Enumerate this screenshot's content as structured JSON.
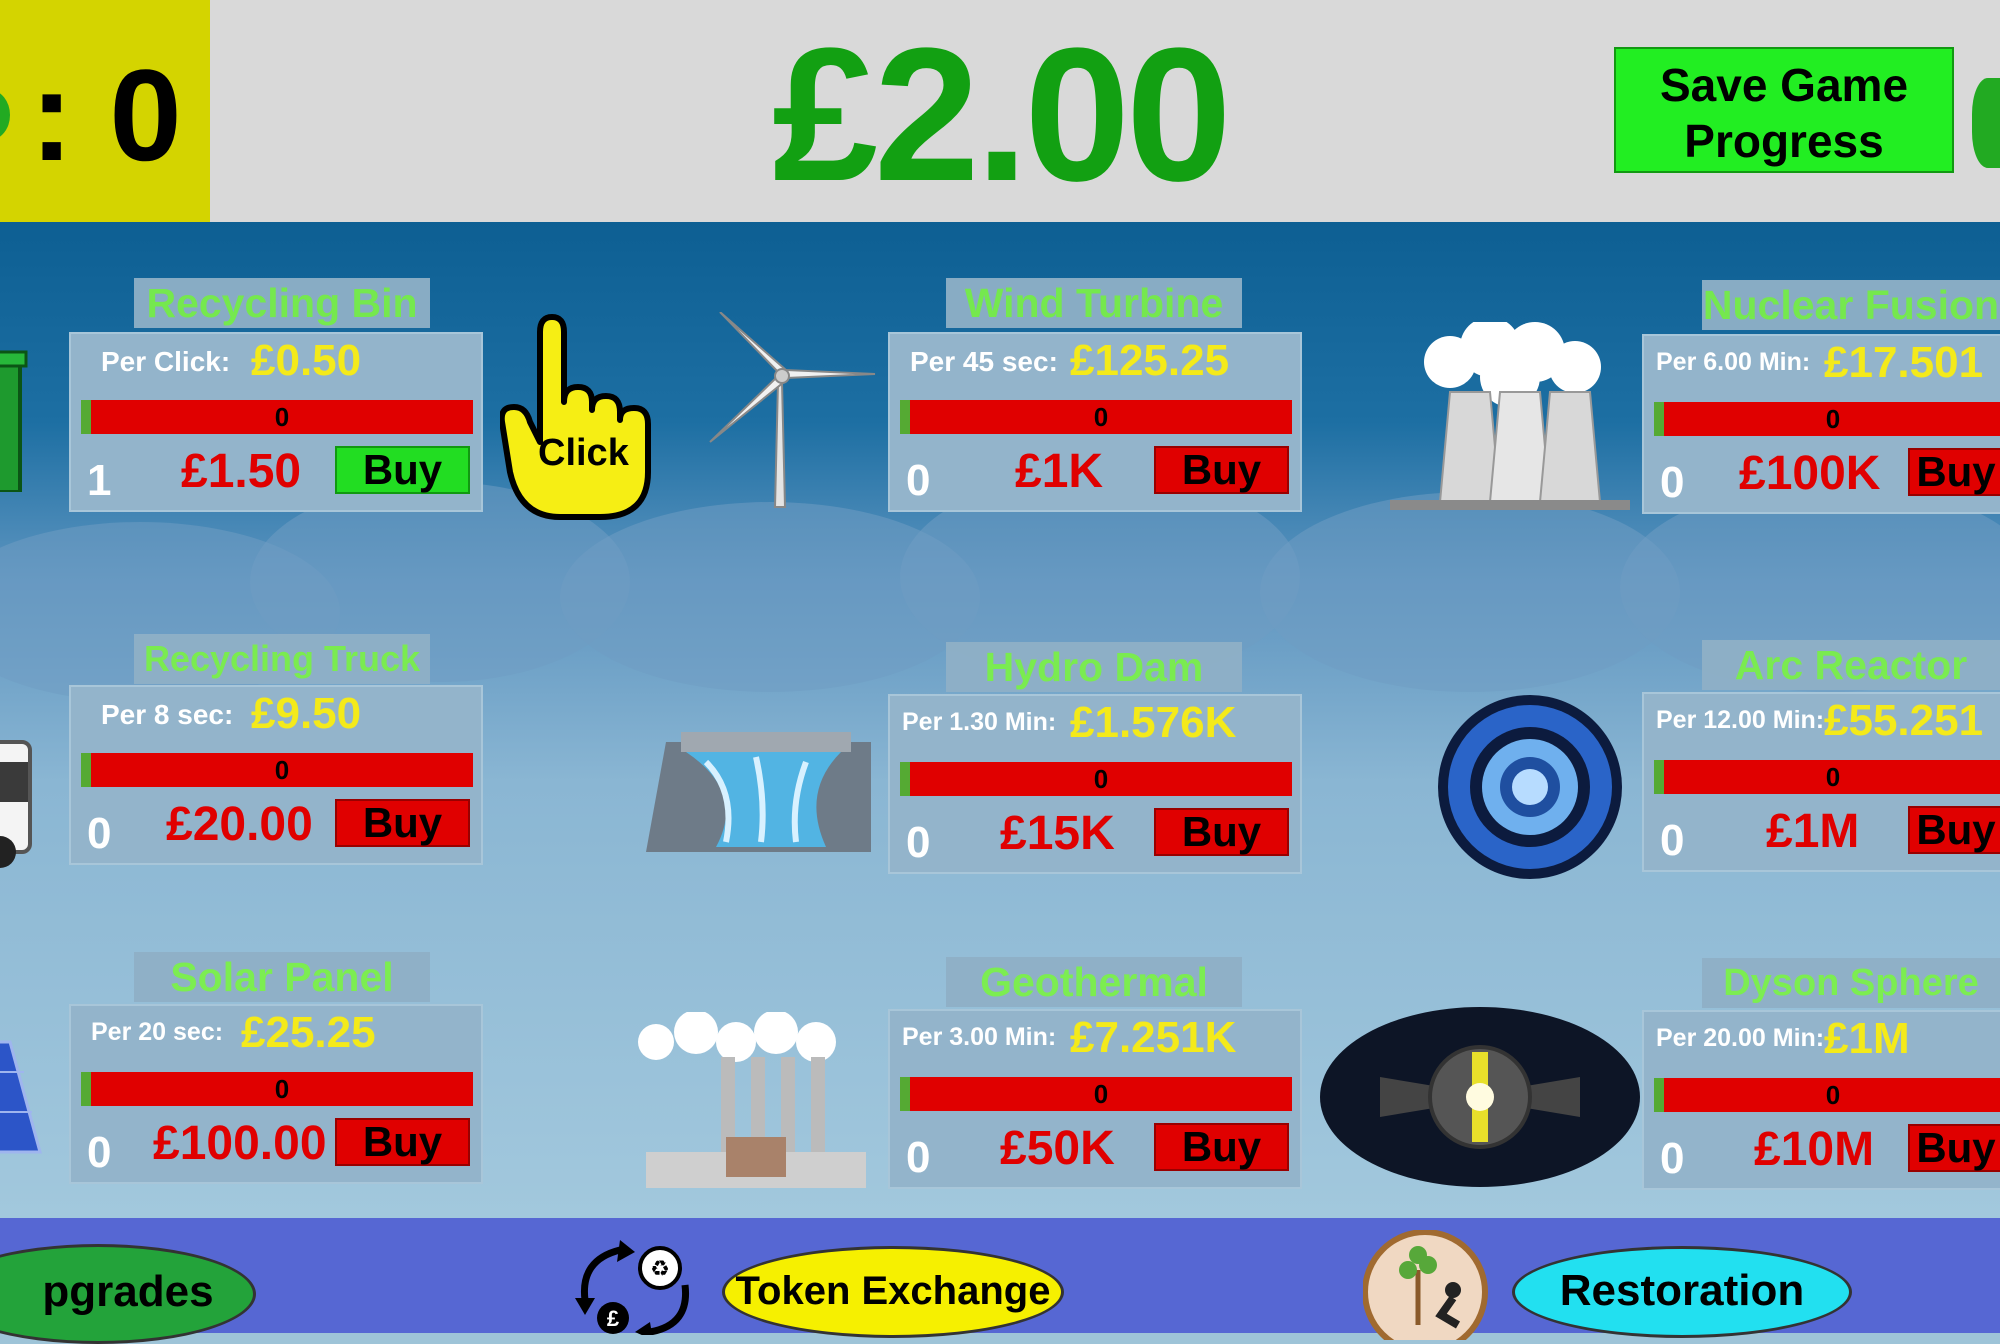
{
  "header": {
    "token_separator_value": ": 0",
    "money": "£2.00",
    "save_button_line1": "Save Game",
    "save_button_line2": "Progress"
  },
  "click_button": {
    "label": "Click"
  },
  "cards": [
    {
      "title": "Recycling Bin",
      "per_label": "Per Click:",
      "per_value": "£0.50",
      "progress": "0",
      "owned": "1",
      "price": "£1.50",
      "buy": "Buy",
      "buy_color": "#22dd22"
    },
    {
      "title": "Recycling Truck",
      "per_label": "Per 8 sec:",
      "per_value": "£9.50",
      "progress": "0",
      "owned": "0",
      "price": "£20.00",
      "buy": "Buy",
      "buy_color": "#e00000"
    },
    {
      "title": "Solar Panel",
      "per_label": "Per 20 sec:",
      "per_value": "£25.25",
      "progress": "0",
      "owned": "0",
      "price": "£100.00",
      "buy": "Buy",
      "buy_color": "#e00000"
    },
    {
      "title": "Wind Turbine",
      "per_label": "Per 45 sec:",
      "per_value": "£125.25",
      "progress": "0",
      "owned": "0",
      "price": "£1K",
      "buy": "Buy",
      "buy_color": "#e00000"
    },
    {
      "title": "Hydro Dam",
      "per_label": "Per 1.30 Min:",
      "per_value": "£1.576K",
      "progress": "0",
      "owned": "0",
      "price": "£15K",
      "buy": "Buy",
      "buy_color": "#e00000"
    },
    {
      "title": "Geothermal",
      "per_label": "Per 3.00 Min:",
      "per_value": "£7.251K",
      "progress": "0",
      "owned": "0",
      "price": "£50K",
      "buy": "Buy",
      "buy_color": "#e00000"
    },
    {
      "title": "Nuclear Fusion",
      "per_label": "Per 6.00 Min:",
      "per_value": "£17.501",
      "progress": "0",
      "owned": "0",
      "price": "£100K",
      "buy": "Buy",
      "buy_color": "#e00000"
    },
    {
      "title": "Arc Reactor",
      "per_label": "Per 12.00 Min:",
      "per_value": "£55.251",
      "progress": "0",
      "owned": "0",
      "price": "£1M",
      "buy": "Buy",
      "buy_color": "#e00000"
    },
    {
      "title": "Dyson Sphere",
      "per_label": "Per 20.00 Min:",
      "per_value": "£1M",
      "progress": "0",
      "owned": "0",
      "price": "£10M",
      "buy": "Buy",
      "buy_color": "#e00000"
    }
  ],
  "bottom": {
    "upgrades": "pgrades",
    "token_exchange": "Token Exchange",
    "restoration": "Restoration"
  },
  "colors": {
    "money_green": "#12a012",
    "title_green": "#7bf04a",
    "per_value_yellow": "#f4ea1a",
    "price_red": "#e00000",
    "token_box_yellow": "#d4d400",
    "bottom_bar_blue": "#5667d3"
  },
  "icons": [
    "token-icon",
    "recycling-bin-icon",
    "pointer-hand-icon",
    "wind-turbine-icon",
    "nuclear-plant-icon",
    "recycling-truck-icon",
    "hydro-dam-icon",
    "arc-reactor-icon",
    "solar-panel-icon",
    "geothermal-plant-icon",
    "dyson-sphere-icon",
    "currency-recycle-icon",
    "restoration-tree-icon"
  ]
}
